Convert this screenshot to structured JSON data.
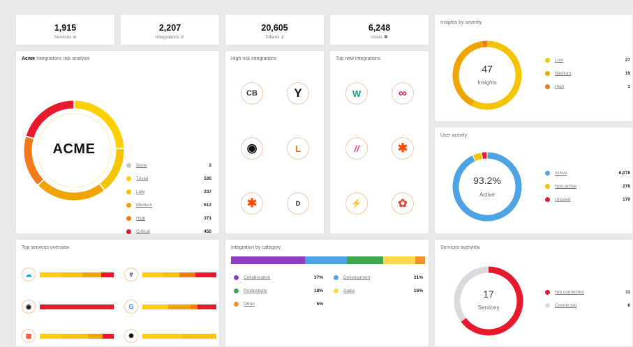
{
  "stats": [
    {
      "value": "1,915",
      "label": "Services",
      "icon": "services-icon"
    },
    {
      "value": "2,207",
      "label": "Integrations",
      "icon": "link-icon"
    },
    {
      "value": "20,605",
      "label": "Tokens",
      "icon": "key-icon"
    },
    {
      "value": "6,248",
      "label": "Users",
      "icon": "users-icon"
    }
  ],
  "risk": {
    "brand": "Acme",
    "title": "Integrations risk analysis",
    "logo": "ACME",
    "items": [
      {
        "name": "None",
        "value": 2,
        "color": "#c8c8cc"
      },
      {
        "name": "Trivial",
        "value": 535,
        "color": "#ffd000"
      },
      {
        "name": "Low",
        "value": 337,
        "color": "#f5c400"
      },
      {
        "name": "Medium",
        "value": 512,
        "color": "#f0a400"
      },
      {
        "name": "High",
        "value": 371,
        "color": "#f07b1a"
      },
      {
        "name": "Critical",
        "value": 450,
        "color": "#e8192c"
      }
    ]
  },
  "high_risk": {
    "title": "High risk integrations",
    "icons": [
      {
        "name": "cb-logo-icon",
        "glyph": "CB",
        "color": "#333"
      },
      {
        "name": "y-logo-icon",
        "glyph": "Y",
        "color": "#111"
      },
      {
        "name": "github-icon",
        "glyph": "◉",
        "color": "#111"
      },
      {
        "name": "l-logo-icon",
        "glyph": "L",
        "color": "#f37021"
      },
      {
        "name": "zapier-icon",
        "glyph": "✱",
        "color": "#ff4a00"
      },
      {
        "name": "d-logo-icon",
        "glyph": "D",
        "color": "#111"
      }
    ]
  },
  "top_new": {
    "title": "Top new integrations",
    "icons": [
      {
        "name": "w-logo-icon",
        "glyph": "W",
        "color": "#1a9e83"
      },
      {
        "name": "infinity-icon",
        "glyph": "∞",
        "color": "#e0226e"
      },
      {
        "name": "monday-icon",
        "glyph": "//",
        "color": "#f0386b"
      },
      {
        "name": "zapier-icon",
        "glyph": "✱",
        "color": "#ff4a00"
      },
      {
        "name": "hyper-icon",
        "glyph": "⚡",
        "color": "#6b2d90"
      },
      {
        "name": "flower-icon",
        "glyph": "✿",
        "color": "#e24a3b"
      }
    ]
  },
  "severity": {
    "title": "Insights by severity",
    "total": "47",
    "label": "Insights",
    "items": [
      {
        "name": "Low",
        "value": 27,
        "color": "#f5c400"
      },
      {
        "name": "Medium",
        "value": 19,
        "color": "#f0a400"
      },
      {
        "name": "High",
        "value": 1,
        "color": "#f07b1a"
      }
    ]
  },
  "activity": {
    "title": "User activity",
    "percent": "93.2%",
    "label": "Active",
    "items": [
      {
        "name": "Active",
        "value": "6,078",
        "amount": 6078,
        "color": "#4da3e3"
      },
      {
        "name": "Non-active",
        "value": "276",
        "amount": 276,
        "color": "#f5c400"
      },
      {
        "name": "Unused",
        "value": "170",
        "amount": 170,
        "color": "#e8192c"
      }
    ]
  },
  "top_services": {
    "title": "Top services overview",
    "rows": [
      {
        "name": "salesforce-icon",
        "glyph": "☁",
        "color": "#00a1e0",
        "segments": [
          [
            0.3,
            "#ffd000"
          ],
          [
            0.28,
            "#f5c400"
          ],
          [
            0.25,
            "#f0a400"
          ],
          [
            0.17,
            "#e8192c"
          ]
        ]
      },
      {
        "name": "slack-icon",
        "glyph": "#",
        "color": "#611f69",
        "segments": [
          [
            0.28,
            "#ffd000"
          ],
          [
            0.22,
            "#f5c400"
          ],
          [
            0.22,
            "#f07b1a"
          ],
          [
            0.28,
            "#e8192c"
          ]
        ]
      },
      {
        "name": "github-icon",
        "glyph": "◉",
        "color": "#111",
        "segments": [
          [
            1.0,
            "#e8192c"
          ]
        ]
      },
      {
        "name": "google-icon",
        "glyph": "G",
        "color": "#4285f4",
        "segments": [
          [
            0.35,
            "#ffd000"
          ],
          [
            0.3,
            "#f0a400"
          ],
          [
            0.1,
            "#f07b1a"
          ],
          [
            0.25,
            "#e8192c"
          ]
        ]
      },
      {
        "name": "microsoft-icon",
        "glyph": "▦",
        "color": "#f25022",
        "segments": [
          [
            0.3,
            "#ffd000"
          ],
          [
            0.35,
            "#f5c400"
          ],
          [
            0.2,
            "#f0a400"
          ],
          [
            0.15,
            "#e8192c"
          ]
        ]
      },
      {
        "name": "openai-icon",
        "glyph": "✺",
        "color": "#111",
        "segments": [
          [
            0.55,
            "#ffd000"
          ],
          [
            0.45,
            "#f5c400"
          ]
        ]
      }
    ]
  },
  "category": {
    "title": "Integration by category",
    "items": [
      {
        "name": "Collaboration",
        "value": "37%",
        "pct": 37,
        "color": "#8e3fbf"
      },
      {
        "name": "Development",
        "value": "21%",
        "pct": 21,
        "color": "#4da3e3"
      },
      {
        "name": "Productivity",
        "value": "18%",
        "pct": 18,
        "color": "#3ea64f"
      },
      {
        "name": "Sales",
        "value": "16%",
        "pct": 16,
        "color": "#ffd84d"
      },
      {
        "name": "Other",
        "value": "5%",
        "pct": 5,
        "color": "#f0932b"
      }
    ]
  },
  "services_overview": {
    "title": "Services overview",
    "total": "17",
    "label": "Services",
    "items": [
      {
        "name": "Not connected",
        "value": 11,
        "color": "#e8192c"
      },
      {
        "name": "Connected",
        "value": 6,
        "color": "#d9d9de"
      }
    ]
  }
}
